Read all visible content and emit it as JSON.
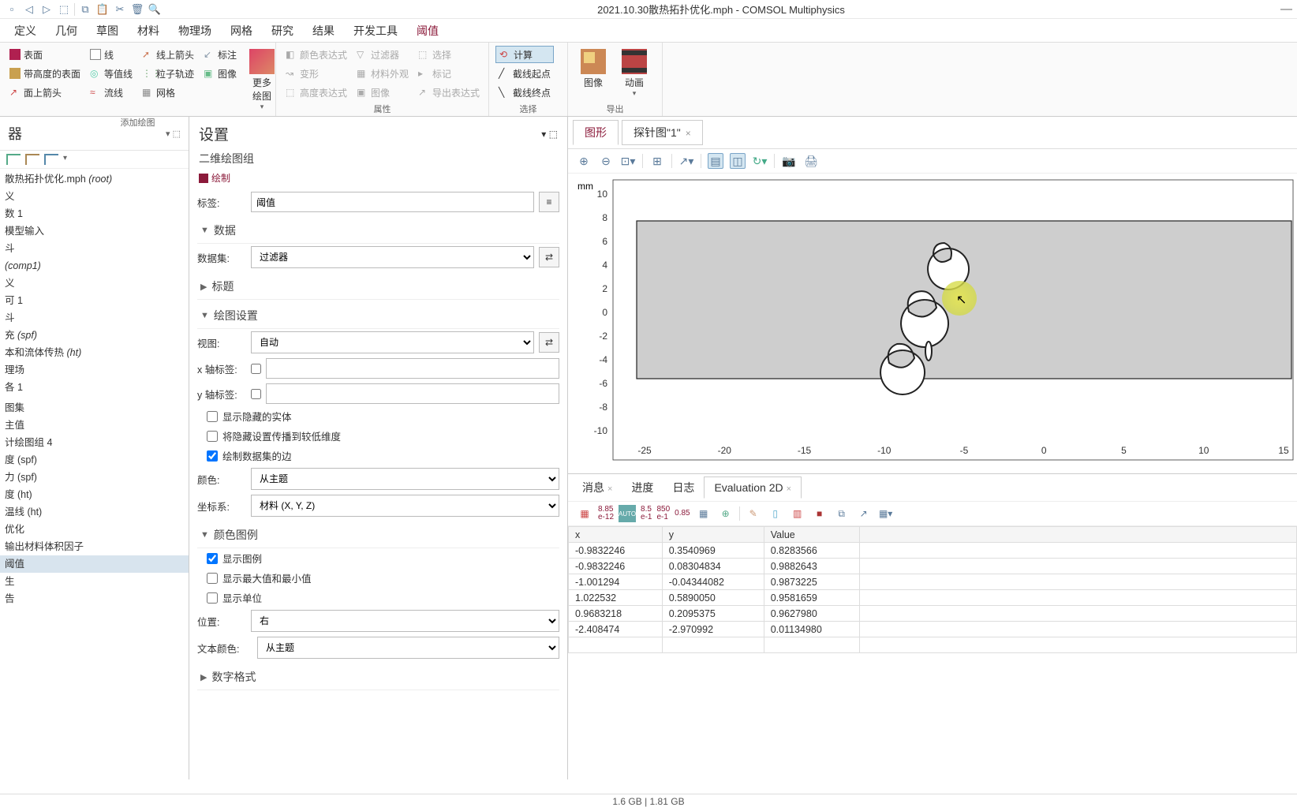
{
  "window": {
    "title": "2021.10.30散热拓扑优化.mph - COMSOL Multiphysics"
  },
  "menu": {
    "items": [
      "定义",
      "几何",
      "草图",
      "材料",
      "物理场",
      "网格",
      "研究",
      "结果",
      "开发工具",
      "阈值"
    ],
    "active_index": 9
  },
  "ribbon": {
    "group1_label": "添加绘图",
    "group2_label": "属性",
    "group3_label": "选择",
    "group4_label": "导出",
    "items": {
      "surface": "表面",
      "height_surface": "带高度的表面",
      "surface_arrow": "面上箭头",
      "line": "线",
      "contour": "等值线",
      "streamline": "流线",
      "line_arrow": "线上箭头",
      "particle": "粒子轨迹",
      "mesh": "网格",
      "annotation": "标注",
      "image": "图像",
      "more_plots": "更多绘图",
      "color_expr": "颜色表达式",
      "deform": "变形",
      "height_expr": "高度表达式",
      "filter": "过滤器",
      "material_appearance": "材料外观",
      "image2": "图像",
      "selection": "选择",
      "marker": "标记",
      "export_expr": "导出表达式",
      "compute": "计算",
      "cut_line_start": "截线起点",
      "cut_line_end": "截线终点",
      "image_export": "图像",
      "animation": "动画"
    }
  },
  "tree": {
    "title": "器",
    "items": [
      {
        "label": "散热拓扑优化.mph (root)",
        "italic": true
      },
      {
        "label": "义"
      },
      {
        "label": "数 1"
      },
      {
        "label": "模型输入"
      },
      {
        "label": "斗"
      },
      {
        "label": " (comp1)",
        "italic": true
      },
      {
        "label": "义"
      },
      {
        "label": "可 1"
      },
      {
        "label": "斗"
      },
      {
        "label": "充 (spf)",
        "italic": true
      },
      {
        "label": "本和流体传热 (ht)",
        "italic": true
      },
      {
        "label": "理场"
      },
      {
        "label": "各 1"
      },
      {
        "label": ""
      },
      {
        "label": "图集"
      },
      {
        "label": "主值"
      },
      {
        "label": "计绘图组 4"
      },
      {
        "label": "度 (spf)"
      },
      {
        "label": "力 (spf)"
      },
      {
        "label": "度 (ht)"
      },
      {
        "label": "温线 (ht)"
      },
      {
        "label": "优化"
      },
      {
        "label": "输出材料体积因子"
      },
      {
        "label": "阈值",
        "selected": true
      },
      {
        "label": "生"
      },
      {
        "label": "告"
      }
    ]
  },
  "settings": {
    "title": "设置",
    "subtitle": "二维绘图组",
    "compute_btn": "绘制",
    "label_field": "标签:",
    "label_value": "阈值",
    "section_data": "数据",
    "dataset_label": "数据集:",
    "dataset_value": "过滤器",
    "section_title": "标题",
    "section_plot": "绘图设置",
    "view_label": "视图:",
    "view_value": "自动",
    "x_axis_label": "x 轴标签:",
    "y_axis_label": "y 轴标签:",
    "chk_hidden": "显示隐藏的实体",
    "chk_propagate": "将隐藏设置传播到较低维度",
    "chk_plot_edges": "绘制数据集的边",
    "color_label": "颜色:",
    "color_value": "从主题",
    "coord_label": "坐标系:",
    "coord_value": "材料 (X, Y, Z)",
    "section_legend": "颜色图例",
    "chk_show_legend": "显示图例",
    "chk_show_maxmin": "显示最大值和最小值",
    "chk_show_units": "显示单位",
    "position_label": "位置:",
    "position_value": "右",
    "text_color_label": "文本颜色:",
    "text_color_value": "从主题",
    "section_number": "数字格式"
  },
  "graphics": {
    "tabs": [
      {
        "label": "图形",
        "active": true
      },
      {
        "label": "探针图\"1\"",
        "closable": true
      }
    ],
    "axis_unit": "mm",
    "y_ticks": [
      "10",
      "8",
      "6",
      "4",
      "2",
      "0",
      "-2",
      "-4",
      "-6",
      "-8",
      "-10"
    ],
    "x_ticks": [
      "-25",
      "-20",
      "-15",
      "-10",
      "-5",
      "0",
      "5",
      "10",
      "15"
    ]
  },
  "bottom": {
    "tabs": [
      {
        "label": "消息",
        "closable": true
      },
      {
        "label": "进度"
      },
      {
        "label": "日志"
      },
      {
        "label": "Evaluation 2D",
        "closable": true,
        "active": true
      }
    ],
    "toolbar_vals": [
      {
        "top": "8.85",
        "bot": "e-12"
      },
      {
        "top": "8.5",
        "bot": "e-1"
      },
      {
        "top": "850",
        "bot": "e-1"
      },
      {
        "top": "0.85",
        "bot": ""
      }
    ]
  },
  "chart_data": {
    "type": "table",
    "columns": [
      "x",
      "y",
      "Value"
    ],
    "rows": [
      [
        "-0.9832246",
        "0.3540969",
        "0.8283566"
      ],
      [
        "-0.9832246",
        "0.08304834",
        "0.9882643"
      ],
      [
        "-1.001294",
        "-0.04344082",
        "0.9873225"
      ],
      [
        "1.022532",
        "0.5890050",
        "0.9581659"
      ],
      [
        "0.9683218",
        "0.2095375",
        "0.9627980"
      ],
      [
        "-2.408474",
        "-2.970992",
        "0.01134980"
      ]
    ]
  },
  "status": {
    "memory": "1.6 GB | 1.81 GB"
  }
}
